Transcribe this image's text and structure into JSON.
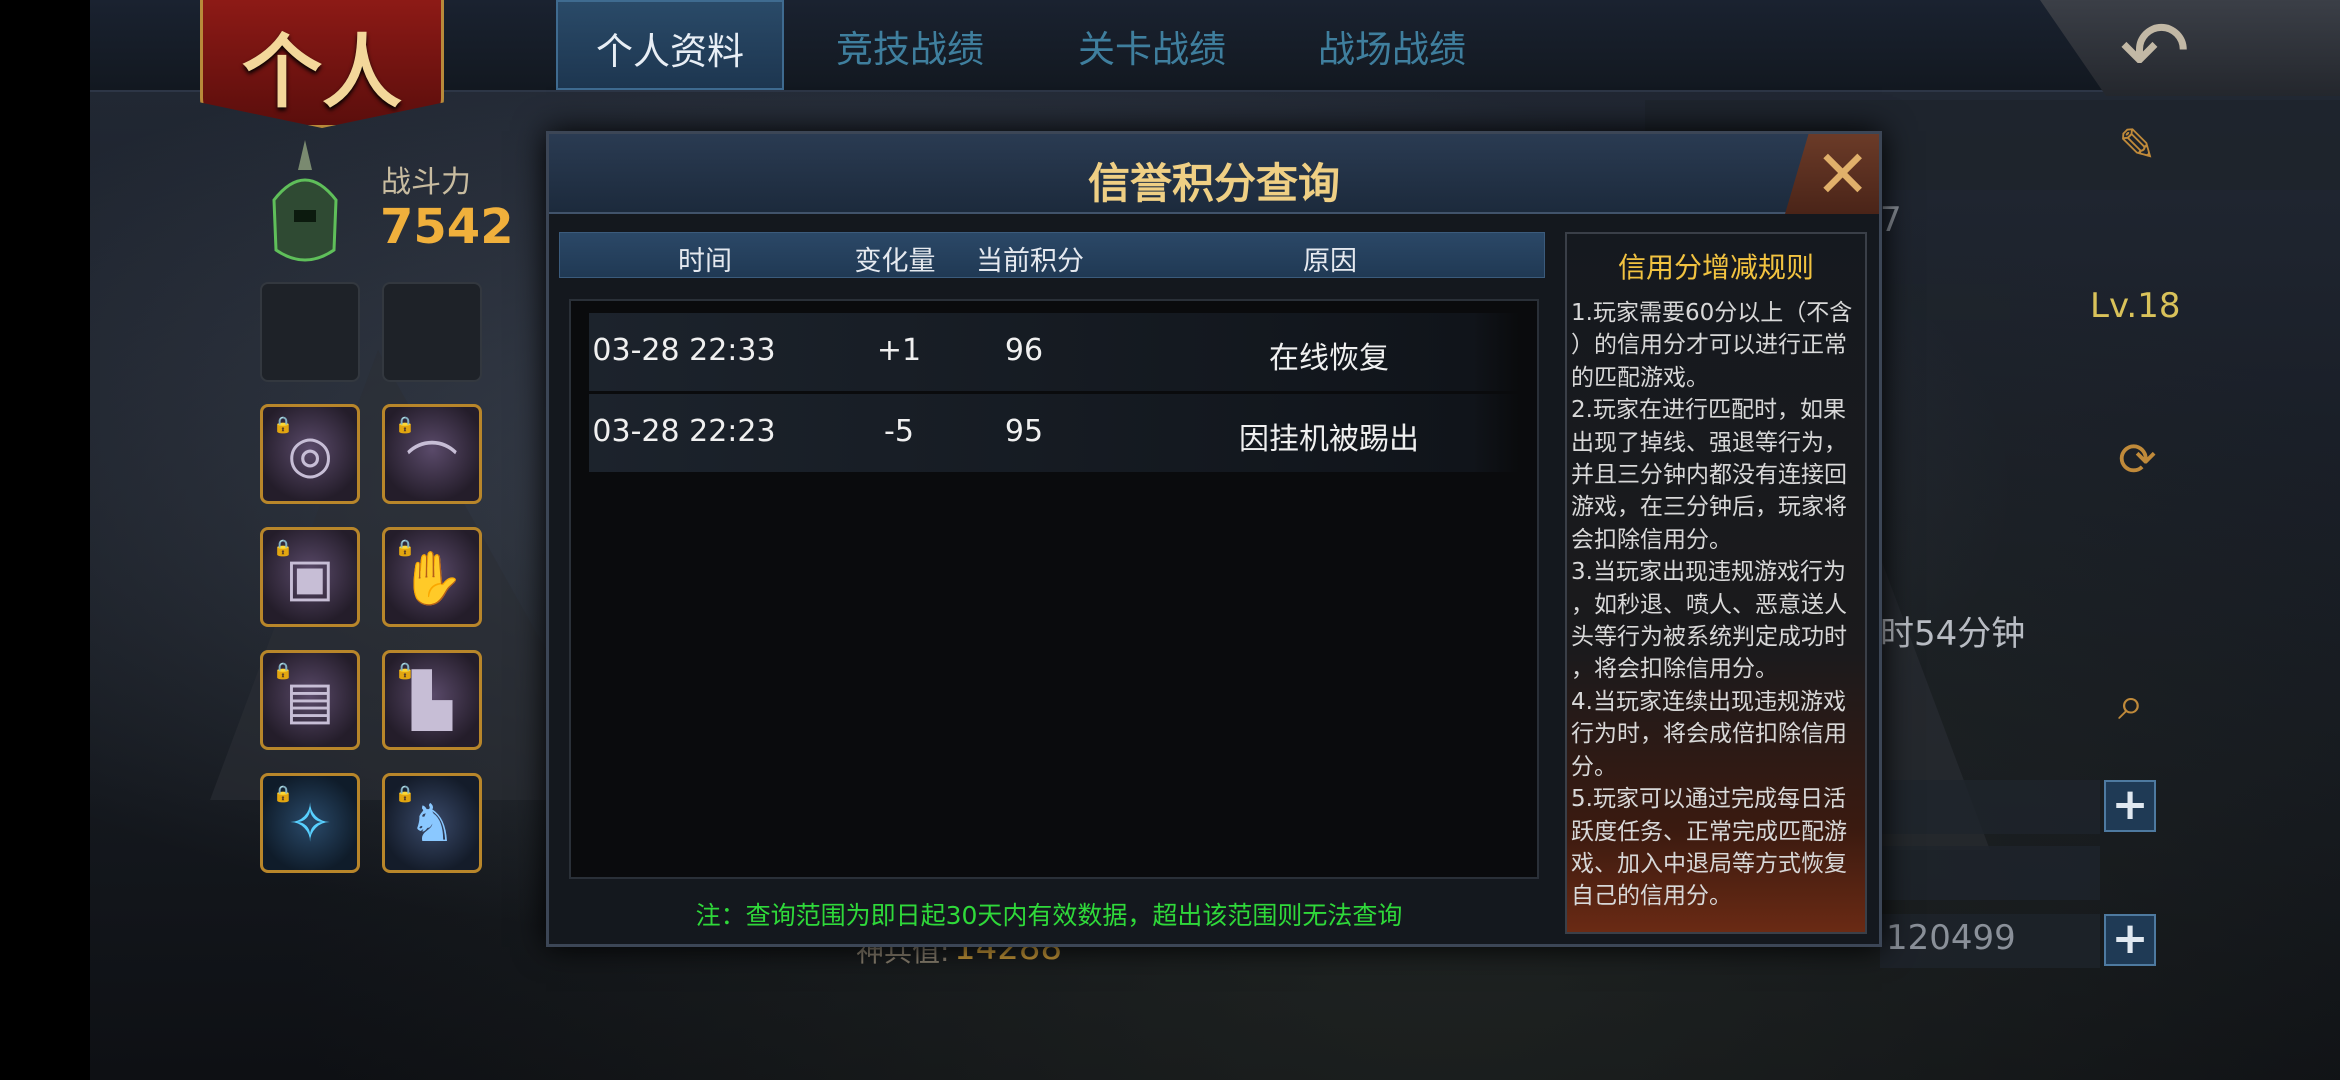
{
  "header": {
    "banner": "个人",
    "tabs": [
      {
        "label": "个人资料",
        "active": true
      },
      {
        "label": "竞技战绩",
        "active": false
      },
      {
        "label": "关卡战绩",
        "active": false
      },
      {
        "label": "战场战绩",
        "active": false
      }
    ],
    "back_icon": "back-arrow-icon"
  },
  "profile": {
    "power_label": "战斗力",
    "power_value": "7542",
    "level": "Lv.18",
    "partial_time_text": "时54分钟",
    "partial_value": "7",
    "partial_bottom_label": "神兵值:",
    "partial_bottom_value": "14288",
    "partial_currency": "120499"
  },
  "modal": {
    "title": "信誉积分查询",
    "close_icon": "close-x-icon",
    "columns": [
      "时间",
      "变化量",
      "当前积分",
      "原因"
    ],
    "rows": [
      {
        "time": "03-28 22:33",
        "change": "+1",
        "score": "96",
        "reason": "在线恢复"
      },
      {
        "time": "03-28 22:23",
        "change": "-5",
        "score": "95",
        "reason": "因挂机被踢出"
      }
    ],
    "note": "注：查询范围为即日起30天内有效数据，超出该范围则无法查询",
    "rules_title": "信用分增减规则",
    "rules_text": "1.玩家需要60分以上（不含\n）的信用分才可以进行正常\n的匹配游戏。\n2.玩家在进行匹配时，如果\n出现了掉线、强退等行为，\n并且三分钟内都没有连接回\n游戏，在三分钟后，玩家将\n会扣除信用分。\n3.当玩家出现违规游戏行为\n，如秒退、喷人、恶意送人\n头等行为被系统判定成功时\n，将会扣除信用分。\n4.当玩家连续出现违规游戏\n行为时，将会成倍扣除信用\n分。\n5.玩家可以通过完成每日活\n跃度任务、正常完成匹配游\n戏、加入中退局等方式恢复\n自己的信用分。"
  },
  "colors": {
    "title_gold": "#efcf84",
    "rules_title": "#f2c340",
    "note_green": "#2fd93a",
    "power_orange": "#f0b03c"
  }
}
